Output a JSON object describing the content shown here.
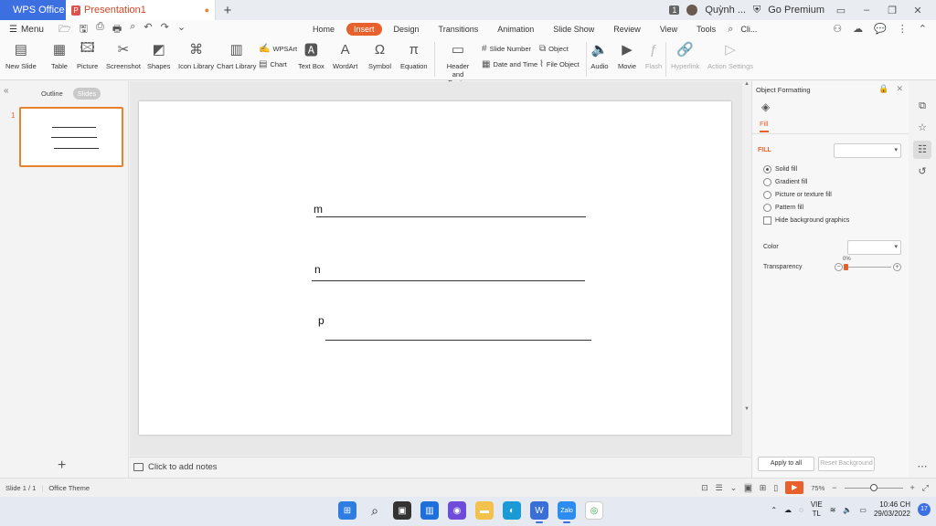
{
  "tabs": {
    "app_tab": "WPS Office",
    "document_tab": "Presentation1",
    "new_tab": "+"
  },
  "titlebar_right": {
    "count_badge": "1",
    "user_name": "Quỳnh ...",
    "premium": "Go Premium"
  },
  "menu": {
    "menu_label": "Menu"
  },
  "ribbon_tabs": [
    "Home",
    "Insert",
    "Design",
    "Transitions",
    "Animation",
    "Slide Show",
    "Review",
    "View",
    "Tools",
    "Cli..."
  ],
  "ribbon_active_tab": "Insert",
  "ribbon_tools": {
    "new_slide": "New Slide",
    "table": "Table",
    "picture": "Picture",
    "screenshot": "Screenshot",
    "shapes": "Shapes",
    "icon_library": "Icon Library",
    "chart_library": "Chart Library",
    "wpsart": "WPSArt",
    "chart": "Chart",
    "text_box": "Text Box",
    "wordart": "WordArt",
    "symbol": "Symbol",
    "equation": "Equation",
    "header_footer": "Header and Footer",
    "slide_number": "Slide Number",
    "date_time": "Date and Time",
    "object": "Object",
    "file_object": "File Object",
    "audio": "Audio",
    "movie": "Movie",
    "flash": "Flash",
    "hyperlink": "Hyperlink",
    "action_settings": "Action Settings"
  },
  "left_panel": {
    "outline_label": "Outline",
    "slides_label": "Slides",
    "slide_number": "1"
  },
  "slide": {
    "labels": [
      "m",
      "n",
      "p"
    ]
  },
  "notes": {
    "placeholder": "Click to add notes"
  },
  "right_panel": {
    "title": "Object Formatting",
    "tab": "Fill",
    "fill_heading": "FILL",
    "options": [
      "Solid fill",
      "Gradient fill",
      "Picture or texture fill",
      "Pattern fill"
    ],
    "selected_option": "Solid fill",
    "hide_background": "Hide background graphics",
    "color_label": "Color",
    "transparency_label": "Transparency",
    "transparency_value": "0%",
    "apply_all": "Apply to all",
    "reset_background": "Reset Background"
  },
  "status": {
    "slide_counter": "Slide 1 / 1",
    "theme": "Office Theme",
    "zoom": "75%"
  },
  "taskbar": {
    "language_line1": "VIE",
    "language_line2": "TL",
    "time": "10:46 CH",
    "date": "29/03/2022",
    "notification_count": "17"
  },
  "colors": {
    "accent": "#e8602c",
    "wps_blue": "#3c6fe0"
  }
}
